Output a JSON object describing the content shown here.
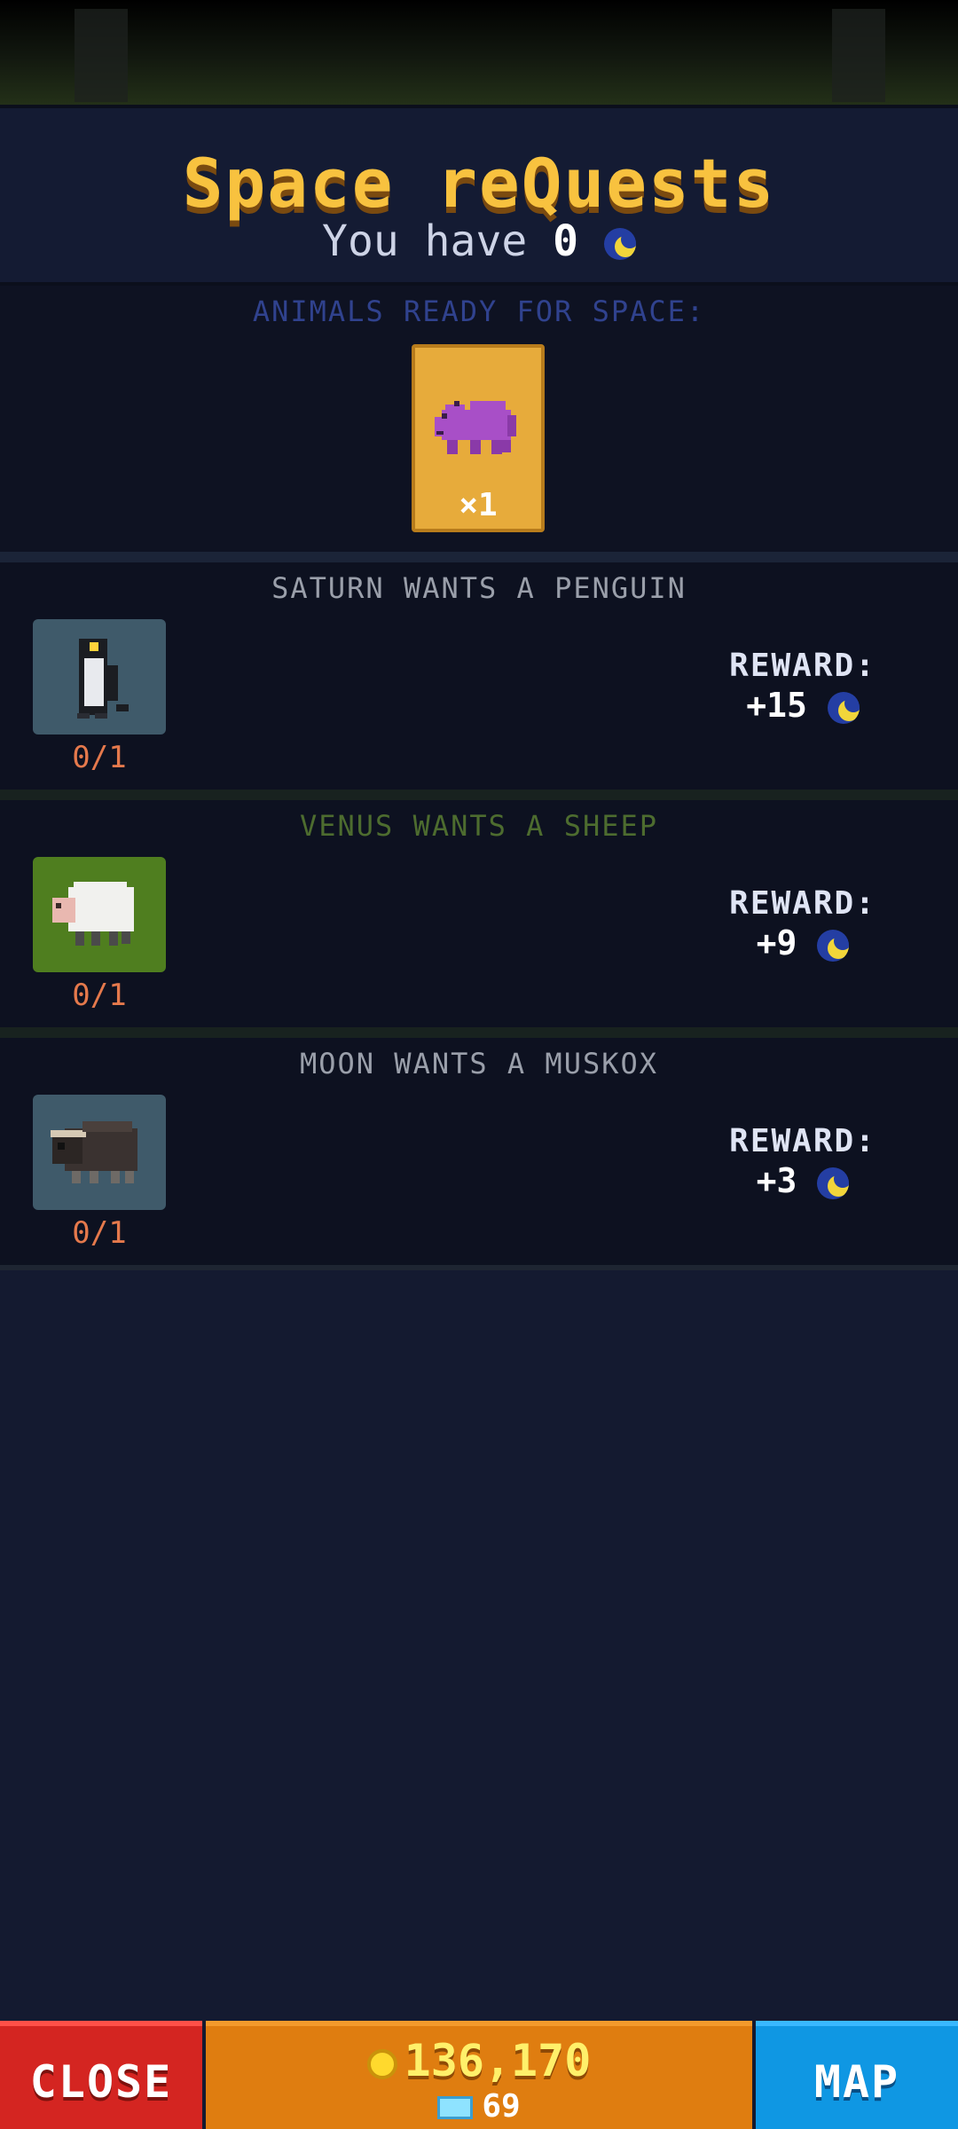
{
  "header": {
    "title": "Space reQuests",
    "you_have_prefix": "You have",
    "you_have_value": "0"
  },
  "ready": {
    "label": "ANIMALS READY FOR SPACE:",
    "cards": [
      {
        "animal": "hippo-icon",
        "count": "×1"
      }
    ]
  },
  "quests": [
    {
      "title": "SATURN WANTS A PENGUIN",
      "animal": "penguin-icon",
      "progress": "0/1",
      "reward_label": "REWARD:",
      "reward_value": "+15",
      "title_color": "#9a9faa",
      "icon_bg": "#3f5a6a"
    },
    {
      "title": "VENUS WANTS A SHEEP",
      "animal": "sheep-icon",
      "progress": "0/1",
      "reward_label": "REWARD:",
      "reward_value": "+9",
      "title_color": "#4d6c2f",
      "icon_bg": "#4f7e1f"
    },
    {
      "title": "MOON WANTS A MUSKOX",
      "animal": "muskox-icon",
      "progress": "0/1",
      "reward_label": "REWARD:",
      "reward_value": "+3",
      "title_color": "#9a9faa",
      "icon_bg": "#3f5a6a"
    }
  ],
  "bottom": {
    "close_label": "CLOSE",
    "coins": "136,170",
    "gems": "69",
    "map_label": "MAP"
  },
  "colors": {
    "title": "#f8c23f",
    "close": "#d42521",
    "coins": "#df7d10",
    "map": "#0f97e3"
  }
}
